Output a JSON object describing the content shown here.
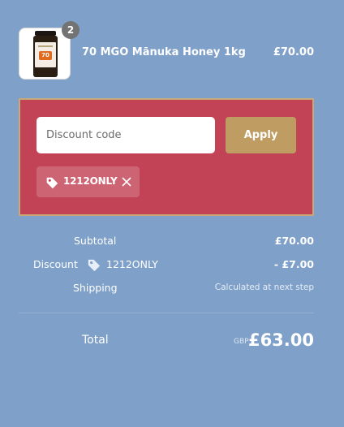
{
  "colors": {
    "background": "#7fa0c8",
    "discount_panel": "#c24356",
    "discount_panel_border": "#c9a877",
    "apply_button": "#bf9d62",
    "quantity_badge": "#737373"
  },
  "product": {
    "image_icon": "honey-jar-image",
    "jar_label_number": "70",
    "quantity": "2",
    "name": "70 MGO Mānuka Honey 1kg",
    "price": "£70.00"
  },
  "discount": {
    "input_placeholder": "Discount code",
    "input_value": "",
    "apply_label": "Apply",
    "applied_tag": {
      "icon": "tag-icon",
      "code": "1212ONLY",
      "remove_icon": "close-icon"
    }
  },
  "summary": {
    "subtotal_label": "Subtotal",
    "subtotal_value": "£70.00",
    "discount_label": "Discount",
    "discount_icon": "tag-icon",
    "discount_code": "1212ONLY",
    "discount_value": "- £7.00",
    "shipping_label": "Shipping",
    "shipping_value": "Calculated at next step",
    "total_label": "Total",
    "currency": "GBP",
    "total_value": "£63.00"
  }
}
